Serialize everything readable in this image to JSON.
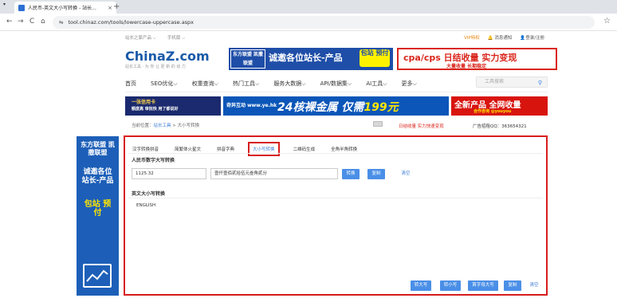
{
  "browser": {
    "tab_title": "人民币-英文大小写转换 - 站长...",
    "tab_close": "×",
    "new_tab": "+",
    "url": "tool.chinaz.com/tools/lowercase-uppercase.aspx",
    "back": "←",
    "forward": "→",
    "reload": "C",
    "home": "⌂",
    "site_info": "⇆",
    "bookmark": "☆",
    "tab_dropdown": "▾"
  },
  "topbar": {
    "links": [
      "站长之家产品 ⌵",
      "手机版 ⌵"
    ],
    "vip": "VIP特权",
    "msg": "消息通知",
    "login": "登录/注册"
  },
  "logo": {
    "text": "ChinaZ.com",
    "sub": "站长工具 · 为 你 让 更 新 的 动 力"
  },
  "banners": {
    "b1_left": "东方联盟 凯撒联盟",
    "b1_main": "诚邀各位站长-产品",
    "b1_right": "包站 预付",
    "b2_main": "cpa/cps 日结收量 实力变现",
    "b2_sub": "大量收量 长期稳定",
    "b3_a": "一张信用卡",
    "b3_b": "额度高 审批快 用了都说好",
    "b4_left": "奇异互动 www.ye.hk",
    "b4_main_a": "24核裸金属 仅需",
    "b4_main_b": "199元",
    "b5_main": "全新产品 全网收量",
    "b5_sub": "合作咨询 @youyou"
  },
  "menu": {
    "items": [
      "首页",
      "SEO优化⌵",
      "权重查询⌵",
      "热门工具⌵",
      "服务大数据⌵",
      "API/数据集⌵",
      "AI工具⌵",
      "更多⌵"
    ],
    "search_placeholder": "工具搜索",
    "search_icon": "⚲"
  },
  "breadcrumb": {
    "prefix": "当前位置：",
    "link": "站长工具",
    "sep": " > ",
    "current": "大小写转换",
    "red": "日结收量 实力快速变现",
    "qq": "广告招租QQ：363654321"
  },
  "sidead": {
    "t1": "东方联盟 凯撒联盟",
    "t2": "诚邀各位 站长-产品",
    "t3": "包站 预付"
  },
  "tool": {
    "tabs": [
      "汉字转换拼音",
      "简繁体火星文",
      "拼音字典",
      "大小写转换",
      "二维码生成",
      "全角半角转换"
    ],
    "active_tab": 3,
    "rmb_title": "人民币数字大写转换",
    "rmb_input": "1125.32",
    "rmb_output": "壹仟壹佰贰拾伍元叁角贰分",
    "btn_convert": "转换",
    "btn_copy": "复制",
    "btn_clear": "清空",
    "en_title": "英文大小写转换",
    "en_text": "ENGLISH",
    "btn_upper": "转大写",
    "btn_lower": "转小写",
    "btn_title": "首字母大写",
    "btn_copy2": "复制",
    "btn_clear2": "清空"
  }
}
